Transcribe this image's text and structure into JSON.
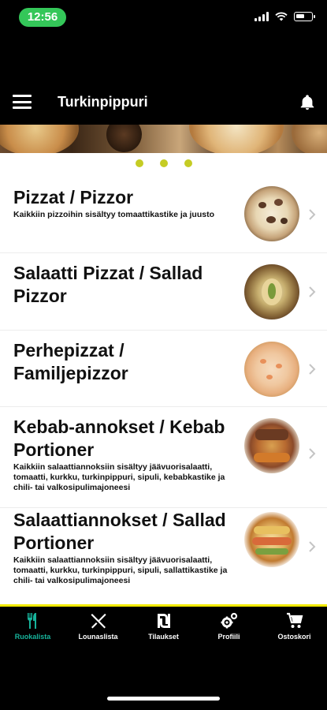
{
  "status_bar": {
    "time": "12:56"
  },
  "header": {
    "title": "Turkinpippuri"
  },
  "carousel": {
    "dots": 3
  },
  "categories": [
    {
      "title": "Pizzat / Pizzor",
      "desc": "Kaikkiin pizzoihin sisältyy tomaattikastike ja juusto"
    },
    {
      "title": "Salaatti Pizzat / Sallad Pizzor",
      "desc": ""
    },
    {
      "title": "Perhepizzat / Familjepizzor",
      "desc": ""
    },
    {
      "title": "Kebab-annokset / Kebab Portioner",
      "desc": "Kaikkiin salaattiannoksiin sisältyy jäävuorisalaatti, tomaatti, kurkku, turkinpippuri, sipuli, kebabkastike ja chili- tai valkosipulimajoneesi"
    },
    {
      "title": "Salaattiannokset / Sallad Portioner",
      "desc": "Kaikkiin salaattiannoksiin sisältyy jäävuorisalaatti, tomaatti, kurkku, turkinpippuri, sipuli, sallattikastike ja chili- tai valkosipulimajoneesi"
    }
  ],
  "tabs": [
    {
      "label": "Ruokalista",
      "icon": "fork-knife-icon",
      "active": true
    },
    {
      "label": "Lounaslista",
      "icon": "utensils-cross-icon",
      "active": false
    },
    {
      "label": "Tilaukset",
      "icon": "shekel-icon",
      "active": false
    },
    {
      "label": "Profiili",
      "icon": "gears-icon",
      "active": false
    },
    {
      "label": "Ostoskori",
      "icon": "cart-icon",
      "active": false
    }
  ],
  "colors": {
    "accent": "#17b39b",
    "dot": "#c5cc24",
    "divider": "#f2ea00",
    "time_pill": "#34c759"
  }
}
